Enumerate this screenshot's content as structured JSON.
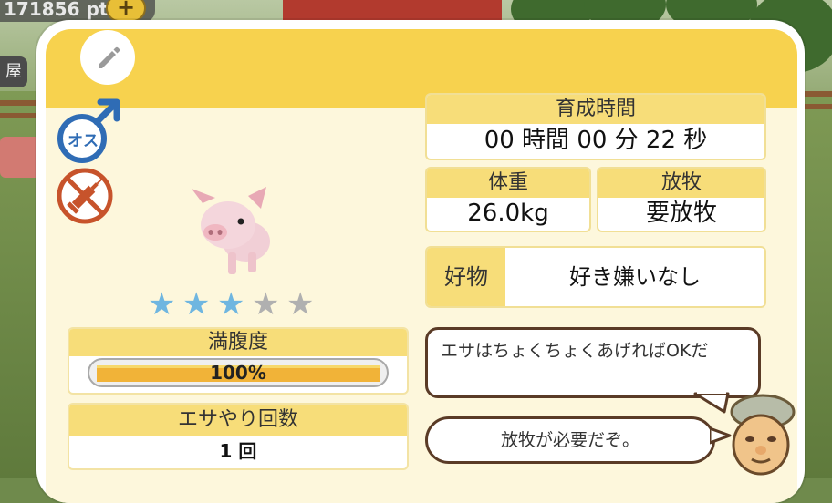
{
  "topbar": {
    "points": "171856 pt",
    "plus": "+",
    "side_tag": "屋"
  },
  "badges": {
    "gender_text": "オス",
    "gender_icon": "male-symbol",
    "vaccine_icon": "no-syringe"
  },
  "animal": {
    "rating": 3,
    "rating_max": 5,
    "stars": [
      "★",
      "★",
      "★",
      "★",
      "★"
    ]
  },
  "fullness": {
    "label": "満腹度",
    "value_text": "100%",
    "value": 1.0
  },
  "feed_count": {
    "label": "エサやり回数",
    "value": "1 回"
  },
  "growth_time": {
    "label": "育成時間",
    "value": "00 時間 00 分 22 秒"
  },
  "weight": {
    "label": "体重",
    "value": "26.0kg"
  },
  "grazing": {
    "label": "放牧",
    "value": "要放牧"
  },
  "favorite": {
    "label": "好物",
    "value": "好き嫌いなし"
  },
  "bubbles": {
    "tip": "エサはちょくちょくあげればOKだ",
    "grazing_tip": "放牧が必要だぞ。"
  },
  "colors": {
    "header_yellow": "#f7d24e",
    "star_on": "#6fb6e0",
    "star_off": "#b0b0b0",
    "meter_fill": "#f1b338"
  }
}
